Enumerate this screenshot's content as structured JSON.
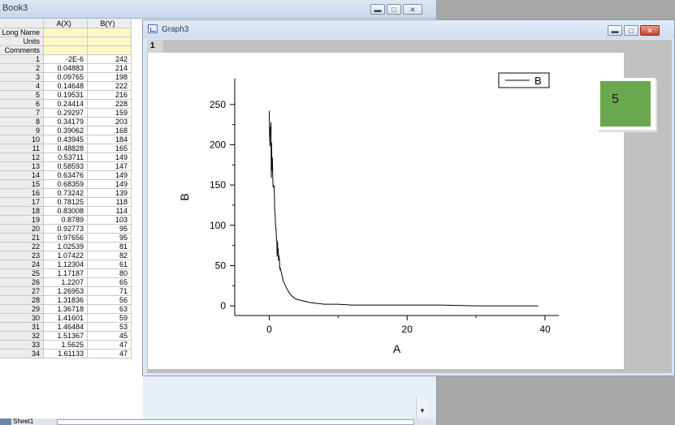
{
  "book": {
    "title": "Book3",
    "columns": [
      "",
      "A(X)",
      "B(Y)"
    ],
    "meta_rows": [
      "Long Name",
      "Units",
      "Comments"
    ],
    "rows": [
      [
        "1",
        "-2E-6",
        "242"
      ],
      [
        "2",
        "0.04883",
        "214"
      ],
      [
        "3",
        "0.09765",
        "198"
      ],
      [
        "4",
        "0.14648",
        "222"
      ],
      [
        "5",
        "0.19531",
        "216"
      ],
      [
        "6",
        "0.24414",
        "228"
      ],
      [
        "7",
        "0.29297",
        "159"
      ],
      [
        "8",
        "0.34179",
        "203"
      ],
      [
        "9",
        "0.39062",
        "168"
      ],
      [
        "10",
        "0.43945",
        "184"
      ],
      [
        "11",
        "0.48828",
        "165"
      ],
      [
        "12",
        "0.53711",
        "149"
      ],
      [
        "13",
        "0.58593",
        "147"
      ],
      [
        "14",
        "0.63476",
        "149"
      ],
      [
        "15",
        "0.68359",
        "149"
      ],
      [
        "16",
        "0.73242",
        "139"
      ],
      [
        "17",
        "0.78125",
        "118"
      ],
      [
        "18",
        "0.83008",
        "114"
      ],
      [
        "19",
        "0.8789",
        "103"
      ],
      [
        "20",
        "0.92773",
        "95"
      ],
      [
        "21",
        "0.97656",
        "95"
      ],
      [
        "22",
        "1.02539",
        "81"
      ],
      [
        "23",
        "1.07422",
        "82"
      ],
      [
        "24",
        "1.12304",
        "61"
      ],
      [
        "25",
        "1.17187",
        "80"
      ],
      [
        "26",
        "1.2207",
        "65"
      ],
      [
        "27",
        "1.26953",
        "71"
      ],
      [
        "28",
        "1.31836",
        "56"
      ],
      [
        "29",
        "1.36718",
        "63"
      ],
      [
        "30",
        "1.41601",
        "59"
      ],
      [
        "31",
        "1.46484",
        "53"
      ],
      [
        "32",
        "1.51367",
        "45"
      ],
      [
        "33",
        "1.5625",
        "47"
      ],
      [
        "34",
        "1.61133",
        "47"
      ]
    ],
    "sheet_tab": "Sheet1"
  },
  "graph": {
    "title": "Graph3",
    "layer_tab": "1",
    "badge_text": "5",
    "badge_color": "#6aa84f"
  },
  "chart_data": {
    "type": "line",
    "xlabel": "A",
    "ylabel": "B",
    "xlim": [
      -5,
      42
    ],
    "ylim": [
      -12,
      282
    ],
    "xticks": [
      0,
      20,
      40
    ],
    "yticks": [
      0,
      50,
      100,
      150,
      200,
      250
    ],
    "legend": "top-right",
    "series": [
      {
        "name": "B",
        "color": "#000000",
        "x": [
          0,
          0.05,
          0.1,
          0.15,
          0.2,
          0.25,
          0.3,
          0.35,
          0.4,
          0.45,
          0.5,
          0.55,
          0.6,
          0.65,
          0.7,
          0.75,
          0.8,
          0.85,
          0.9,
          0.95,
          1.0,
          1.05,
          1.1,
          1.15,
          1.2,
          1.25,
          1.3,
          1.35,
          1.4,
          1.45,
          1.5,
          1.55,
          1.6,
          1.8,
          2.0,
          2.2,
          2.5,
          2.8,
          3.0,
          3.3,
          3.6,
          4.0,
          4.5,
          5.0,
          6.0,
          7.0,
          8.0,
          10.0,
          12.0,
          15.0,
          20.0,
          25.0,
          30.0,
          35.0,
          39.0
        ],
        "y": [
          242,
          214,
          198,
          222,
          216,
          228,
          159,
          203,
          168,
          184,
          165,
          149,
          147,
          149,
          149,
          139,
          118,
          114,
          103,
          95,
          95,
          81,
          82,
          61,
          80,
          65,
          71,
          56,
          63,
          59,
          53,
          45,
          47,
          40,
          32,
          28,
          22,
          18,
          15,
          12,
          10,
          8,
          7,
          6,
          4,
          3,
          2,
          2,
          1,
          1,
          1,
          1,
          0,
          0,
          0
        ]
      }
    ]
  }
}
